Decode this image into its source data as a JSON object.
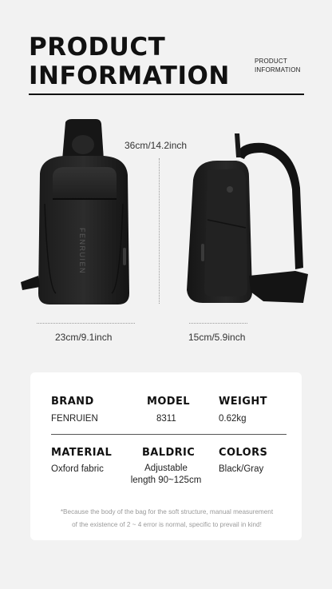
{
  "header": {
    "title_line1": "PRODUCT",
    "title_line2": "INFORMATION",
    "subtitle_line1": "PRODUCT",
    "subtitle_line2": "INFORMATION"
  },
  "dimensions": {
    "height": "36cm/14.2inch",
    "width": "23cm/9.1inch",
    "depth": "15cm/5.9inch"
  },
  "specs": {
    "brand_label": "BRAND",
    "brand_value": "FENRUIEN",
    "model_label": "MODEL",
    "model_value": "8311",
    "weight_label": "WEIGHT",
    "weight_value": "0.62kg",
    "material_label": "MATERIAL",
    "material_value": "Oxford fabric",
    "baldric_label": "BALDRIC",
    "baldric_value_line1": "Adjustable",
    "baldric_value_line2": "length 90~125cm",
    "colors_label": "COLORS",
    "colors_value": "Black/Gray",
    "note_line1": "*Because the body of the bag for the soft structure, manual measurement",
    "note_line2": "of the existence of 2 ~ 4 error is normal, specific to prevail in kind!"
  },
  "brand_logo_text": "FENRUIEN"
}
